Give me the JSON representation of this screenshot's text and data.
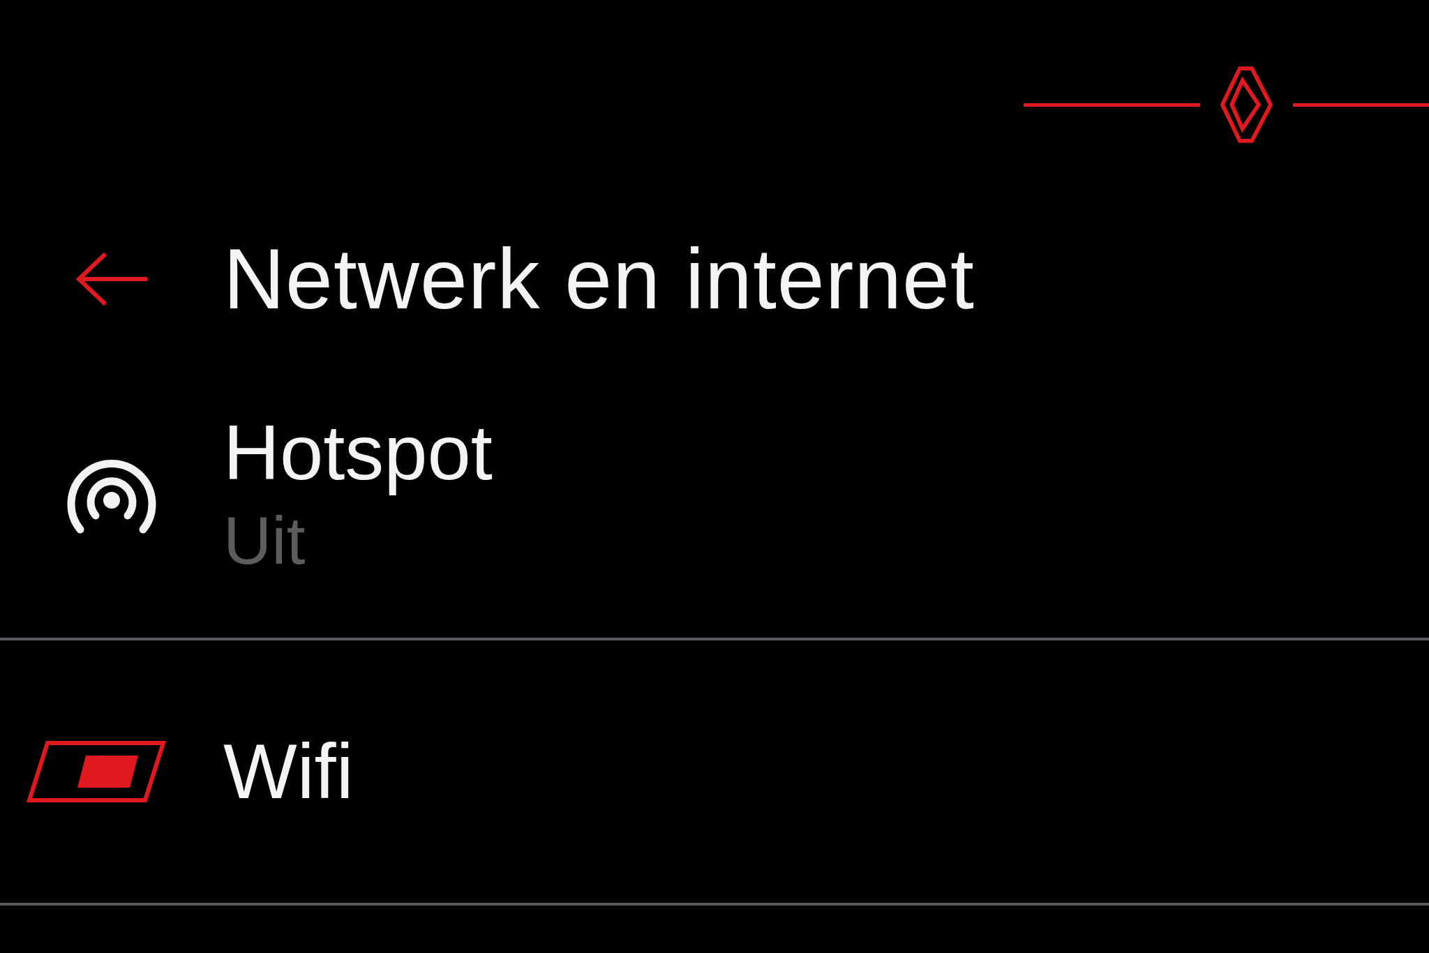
{
  "header": {
    "title": "Netwerk en internet"
  },
  "items": [
    {
      "kind": "status",
      "label": "Hotspot",
      "status": "Uit"
    },
    {
      "kind": "toggle",
      "label": "Wifi",
      "on": true
    }
  ]
}
